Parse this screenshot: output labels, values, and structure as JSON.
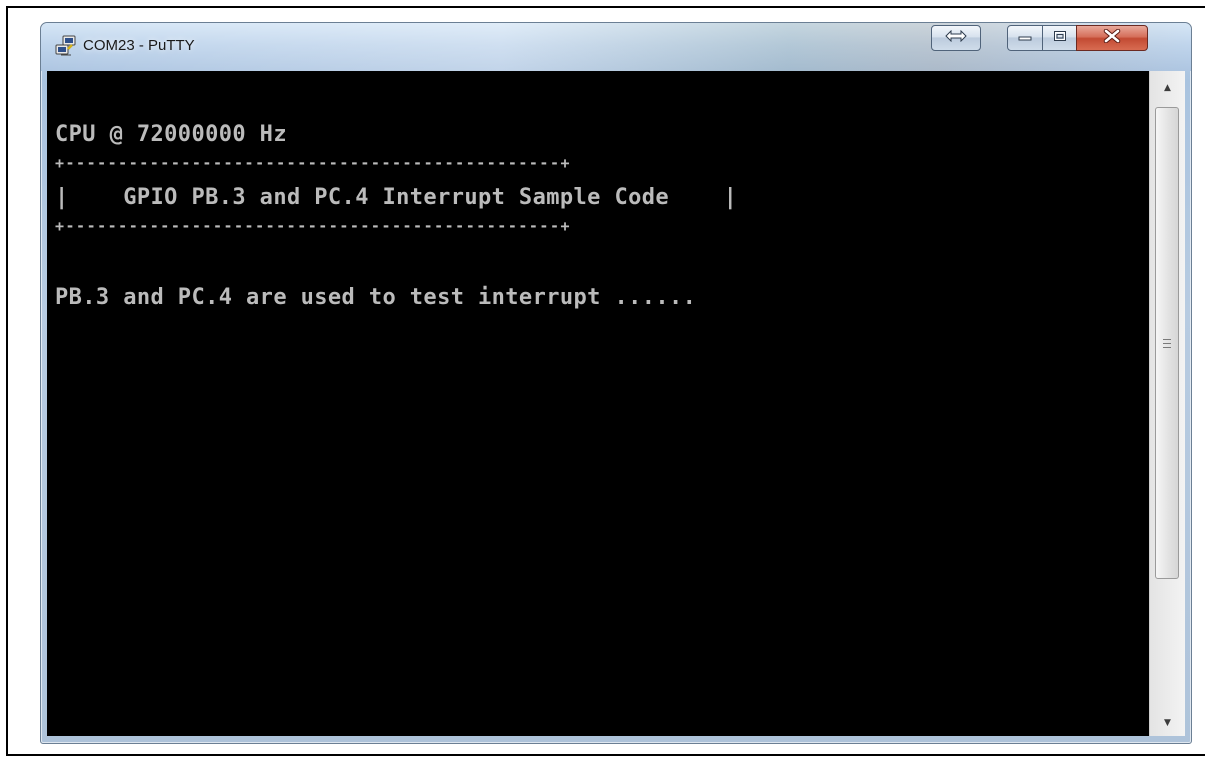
{
  "window": {
    "title": "COM23 - PuTTY"
  },
  "icons": {
    "app": "putty-icon",
    "resize": "double-arrow-icon",
    "minimize": "minimize-icon",
    "maximize": "maximize-icon",
    "close": "close-icon",
    "scroll_up": "arrow-up-icon",
    "scroll_down": "arrow-down-icon",
    "scroll_grip": "grip-icon"
  },
  "terminal": {
    "lines": [
      "CPU @ 72000000 Hz",
      "+-----------------------------------------------+",
      "|    GPIO PB.3 and PC.4 Interrupt Sample Code    |",
      "+-----------------------------------------------+",
      "PB.3 and PC.4 are used to test interrupt ......"
    ],
    "background": "#000000",
    "foreground": "#bbbbbb"
  },
  "colors": {
    "close_button": "#c8503a",
    "titlebar": "#c0d5ec"
  }
}
